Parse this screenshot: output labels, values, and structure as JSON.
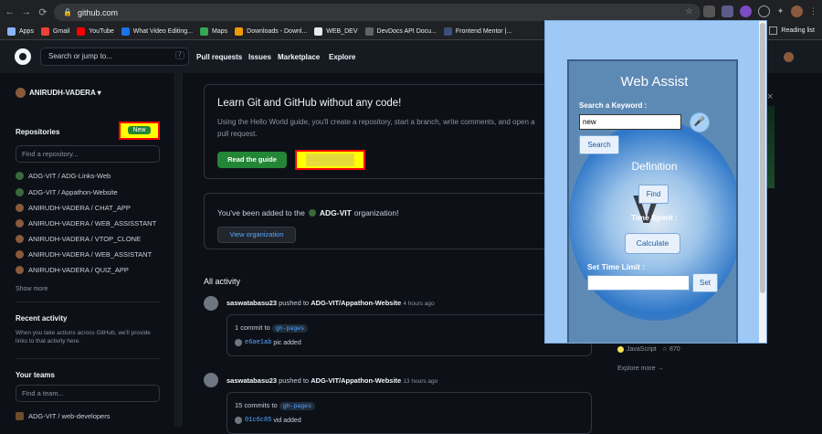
{
  "browser": {
    "url": "github.com",
    "nav": {
      "back": "←",
      "forward": "→",
      "reload": "⟳"
    }
  },
  "bookmarks": [
    {
      "label": "Apps",
      "color": "#8ab4f8"
    },
    {
      "label": "Gmail",
      "color": "#ea4335"
    },
    {
      "label": "YouTube",
      "color": "#ff0000"
    },
    {
      "label": "What Video Editing...",
      "color": "#1a73e8"
    },
    {
      "label": "Maps",
      "color": "#34a853"
    },
    {
      "label": "Downloads - Downl...",
      "color": "#f29900"
    },
    {
      "label": "WEB_DEV",
      "color": "#e8eaed"
    },
    {
      "label": "DevDocs API Docu...",
      "color": "#5f6368"
    },
    {
      "label": "Frontend Mentor |...",
      "color": "#3d4f7a"
    }
  ],
  "bookmarks_right": "Reading list",
  "github": {
    "search_placeholder": "Search or jump to...",
    "slash": "/",
    "nav": [
      "Pull requests",
      "Issues",
      "Marketplace",
      "Explore"
    ],
    "user": "ANIRUDH-VADERA ▾",
    "repositories_title": "Repositories",
    "new_label": "New",
    "find_repo_placeholder": "Find a repository...",
    "repos": [
      "ADG-VIT / ADG-Links-Web",
      "ADG-VIT / Appathon-Website",
      "ANIRUDH-VADERA / CHAT_APP",
      "ANIRUDH-VADERA / WEB_ASSISSTANT",
      "ANIRUDH-VADERA / VTOP_CLONE",
      "ANIRUDH-VADERA / WEB_ASSISTANT",
      "ANIRUDH-VADERA / QUIZ_APP"
    ],
    "show_more": "Show more",
    "recent_activity_title": "Recent activity",
    "recent_activity_text": "When you take actions across GitHub, we'll provide links to that activity here.",
    "your_teams_title": "Your teams",
    "find_team_placeholder": "Find a team...",
    "team": "ADG-VIT / web-developers",
    "learn": {
      "title": "Learn Git and GitHub without any code!",
      "text": "Using the Hello World guide, you'll create a repository, start a branch, write comments, and open a pull request.",
      "read_guide": "Read the guide",
      "start_project": "Start a project"
    },
    "org": {
      "text": "You've been added to the",
      "org_name": "ADG-VIT",
      "suffix": "organization!",
      "view": "View organization"
    },
    "all_activity": "All activity",
    "activities": [
      {
        "user": "saswatabasu23",
        "action": "pushed to",
        "repo": "ADG-VIT/Appathon-Website",
        "time": "4 hours ago",
        "commits": "1 commit to",
        "branch": "gh-pages",
        "sha": "e6ae1ab",
        "message": "pic added"
      },
      {
        "user": "saswatabasu23",
        "action": "pushed to",
        "repo": "ADG-VIT/Appathon-Website",
        "time": "13 hours ago",
        "commits": "15 commits to",
        "branch": "gh-pages",
        "sha": "01c6c85",
        "message": "vid added"
      }
    ],
    "explore": {
      "language": "JavaScript",
      "stars": "870",
      "explore_more": "Explore more →",
      "close": "×"
    }
  },
  "web_assist": {
    "title": "Web Assist",
    "search_label": "Search a Keyword :",
    "input_value": "new",
    "search_btn": "Search",
    "definition": "Definition",
    "find_btn": "Find",
    "time_spent": "Time Spent :",
    "calculate_btn": "Calculate",
    "set_limit_label": "Set Time Limit :",
    "limit_value": "",
    "set_btn": "Set",
    "watermark": "V"
  }
}
